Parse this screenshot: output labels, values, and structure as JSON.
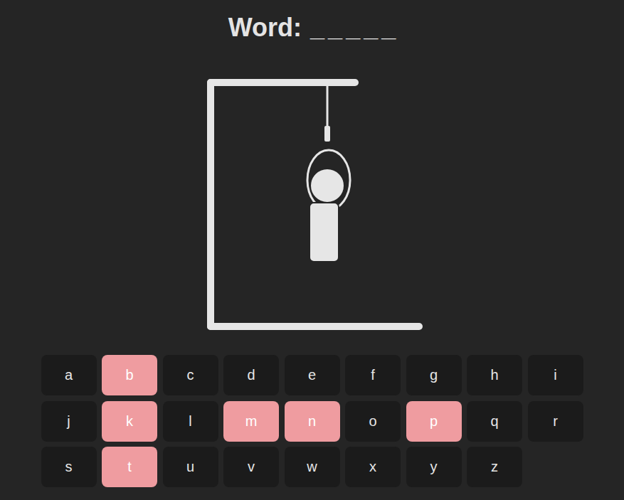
{
  "word": {
    "label": "Word:",
    "letters": [
      "_",
      "_",
      "_",
      "_",
      "_"
    ]
  },
  "figure": {
    "parts": [
      {
        "kind": "head",
        "shown": true
      },
      {
        "kind": "body",
        "shown": true
      },
      {
        "kind": "left-arm",
        "shown": false
      },
      {
        "kind": "right-arm",
        "shown": false
      },
      {
        "kind": "left-leg",
        "shown": false
      },
      {
        "kind": "right-leg",
        "shown": false
      }
    ]
  },
  "keys": [
    {
      "letter": "a",
      "guessed": false
    },
    {
      "letter": "b",
      "guessed": true
    },
    {
      "letter": "c",
      "guessed": false
    },
    {
      "letter": "d",
      "guessed": false
    },
    {
      "letter": "e",
      "guessed": false
    },
    {
      "letter": "f",
      "guessed": false
    },
    {
      "letter": "g",
      "guessed": false
    },
    {
      "letter": "h",
      "guessed": false
    },
    {
      "letter": "i",
      "guessed": false
    },
    {
      "letter": "j",
      "guessed": false
    },
    {
      "letter": "k",
      "guessed": true
    },
    {
      "letter": "l",
      "guessed": false
    },
    {
      "letter": "m",
      "guessed": true
    },
    {
      "letter": "n",
      "guessed": true
    },
    {
      "letter": "o",
      "guessed": false
    },
    {
      "letter": "p",
      "guessed": true
    },
    {
      "letter": "q",
      "guessed": false
    },
    {
      "letter": "r",
      "guessed": false
    },
    {
      "letter": "s",
      "guessed": false
    },
    {
      "letter": "t",
      "guessed": true
    },
    {
      "letter": "u",
      "guessed": false
    },
    {
      "letter": "v",
      "guessed": false
    },
    {
      "letter": "w",
      "guessed": false
    },
    {
      "letter": "x",
      "guessed": false
    },
    {
      "letter": "y",
      "guessed": false
    },
    {
      "letter": "z",
      "guessed": false
    }
  ]
}
